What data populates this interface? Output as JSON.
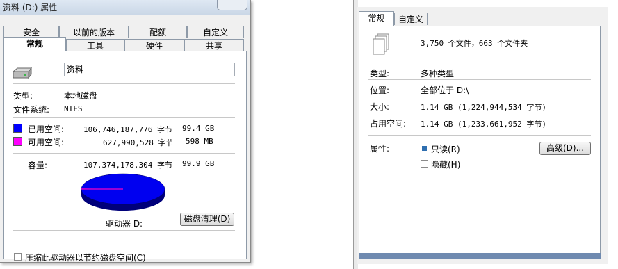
{
  "left": {
    "title": "资料 (D:) 属性",
    "tabs_row1": [
      "安全",
      "以前的版本",
      "配额",
      "自定义"
    ],
    "tabs_row2": [
      "常规",
      "工具",
      "硬件",
      "共享"
    ],
    "name_value": "资料",
    "type_label": "类型:",
    "type_value": "本地磁盘",
    "fs_label": "文件系统:",
    "fs_value": "NTFS",
    "used": {
      "label": "已用空间:",
      "bytes": "106,746,187,776 字节",
      "size": "99.4 GB",
      "color": "#0000ff"
    },
    "free": {
      "label": "可用空间:",
      "bytes": "627,990,528 字节",
      "size": "598 MB",
      "color": "#ff00ff"
    },
    "capacity": {
      "label": "容量:",
      "bytes": "107,374,178,304 字节",
      "size": "99.9 GB"
    },
    "drive_label": "驱动器 D:",
    "cleanup_button": "磁盘清理(D)",
    "compress_checkbox": "压缩此驱动器以节约磁盘空间(C)",
    "pie": {
      "used_fraction": 0.9942,
      "free_fraction": 0.0058
    }
  },
  "right": {
    "tabs": [
      "常规",
      "自定义"
    ],
    "summary": "3,750 个文件，663 个文件夹",
    "type_label": "类型:",
    "type_value": "多种类型",
    "location_label": "位置:",
    "location_value": "全部位于 D:\\",
    "size_label": "大小:",
    "size_value": "1.14 GB (1,224,944,534 字节)",
    "disk_size_label": "占用空间:",
    "disk_size_value": "1.14 GB (1,233,661,952 字节)",
    "attributes_label": "属性:",
    "readonly_label": "只读(R)",
    "hidden_label": "隐藏(H)",
    "advanced_button": "高级(D)..."
  }
}
